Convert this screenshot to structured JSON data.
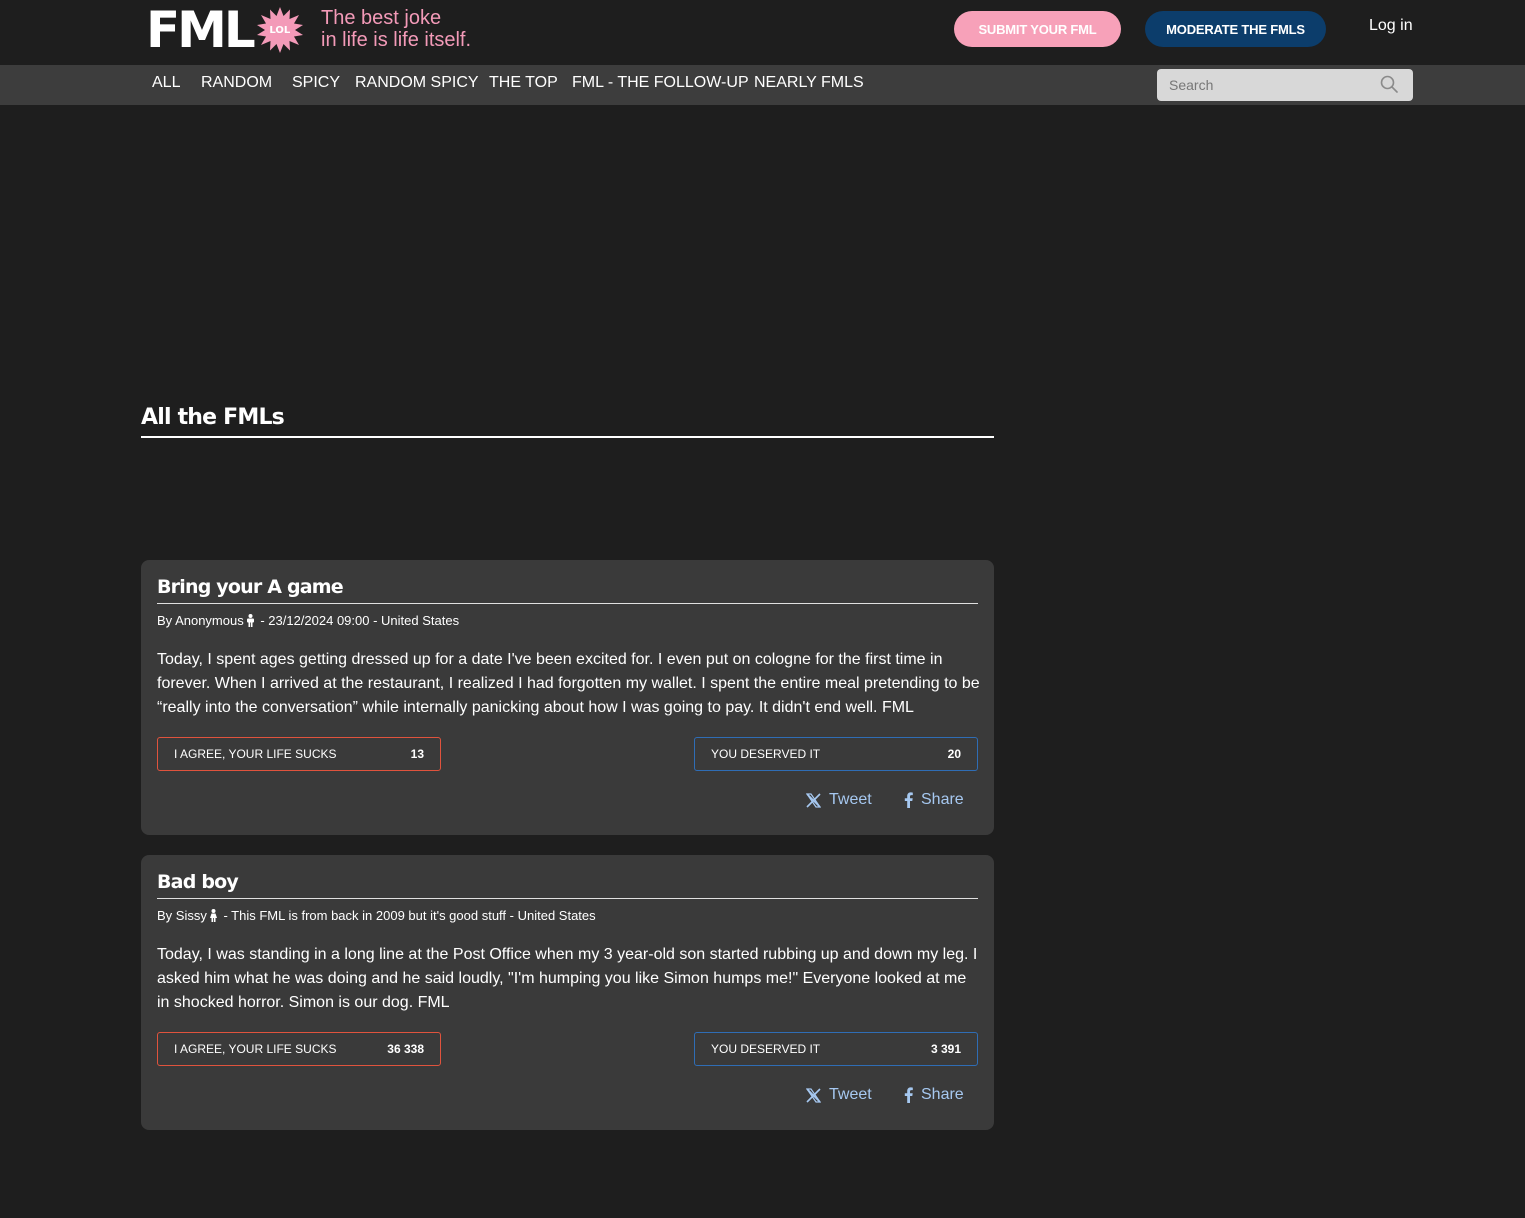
{
  "header": {
    "logo_text": "FML",
    "logo_badge": "LOL",
    "tagline_line1": "The best joke",
    "tagline_line2": "in life is life itself.",
    "submit_label": "SUBMIT YOUR FML",
    "moderate_label": "MODERATE THE FMLS",
    "login_label": "Log in"
  },
  "nav": {
    "items": [
      {
        "label": "ALL"
      },
      {
        "label": "RANDOM"
      },
      {
        "label": "SPICY"
      },
      {
        "label": "RANDOM SPICY"
      },
      {
        "label": "THE TOP"
      },
      {
        "label": "FML - THE FOLLOW-UP"
      },
      {
        "label": "NEARLY FMLS"
      }
    ],
    "search_placeholder": "Search"
  },
  "main": {
    "section_title": "All the FMLs",
    "posts": [
      {
        "title": "Bring your A game",
        "author": "By Anonymous",
        "meta": " - 23/12/2024 09:00 - United States",
        "body": "Today, I spent ages getting dressed up for a date I've been excited for. I even put on cologne for the first time in forever. When I arrived at the restaurant, I realized I had forgotten my wallet. I spent the entire meal pretending to be “really into the conversation” while internally panicking about how I was going to pay. It didn't end well. FML",
        "agree_label": "I AGREE, YOUR LIFE SUCKS",
        "agree_count": "13",
        "deserved_label": "YOU DESERVED IT",
        "deserved_count": "20",
        "tweet_label": "Tweet",
        "share_label": "Share"
      },
      {
        "title": "Bad boy",
        "author": "By Sissy",
        "meta": " - This FML is from back in 2009 but it's good stuff - United States",
        "body": "Today, I was standing in a long line at the Post Office when my 3 year-old son started rubbing up and down my leg. I asked him what he was doing and he said loudly, \"I'm humping you like Simon humps me!\" Everyone looked at me in shocked horror. Simon is our dog. FML",
        "agree_label": "I AGREE, YOUR LIFE SUCKS",
        "agree_count": "36 338",
        "deserved_label": "YOU DESERVED IT",
        "deserved_count": "3 391",
        "tweet_label": "Tweet",
        "share_label": "Share"
      }
    ]
  },
  "colors": {
    "background": "#1e1e1e",
    "navbar": "#3d3d3d",
    "card": "#3a3a3a",
    "brand_pink": "#f39ab8",
    "submit_button": "#f7a1b9",
    "moderate_button": "#0c3d6b",
    "agree_border": "#e0533d",
    "deserved_border": "#2f6db5",
    "share_link": "#a6c8f0"
  },
  "icons": {
    "badge": "starburst-badge-icon",
    "search": "search-icon",
    "person": "person-icon",
    "tweet": "x-logo-icon",
    "share": "facebook-icon"
  }
}
